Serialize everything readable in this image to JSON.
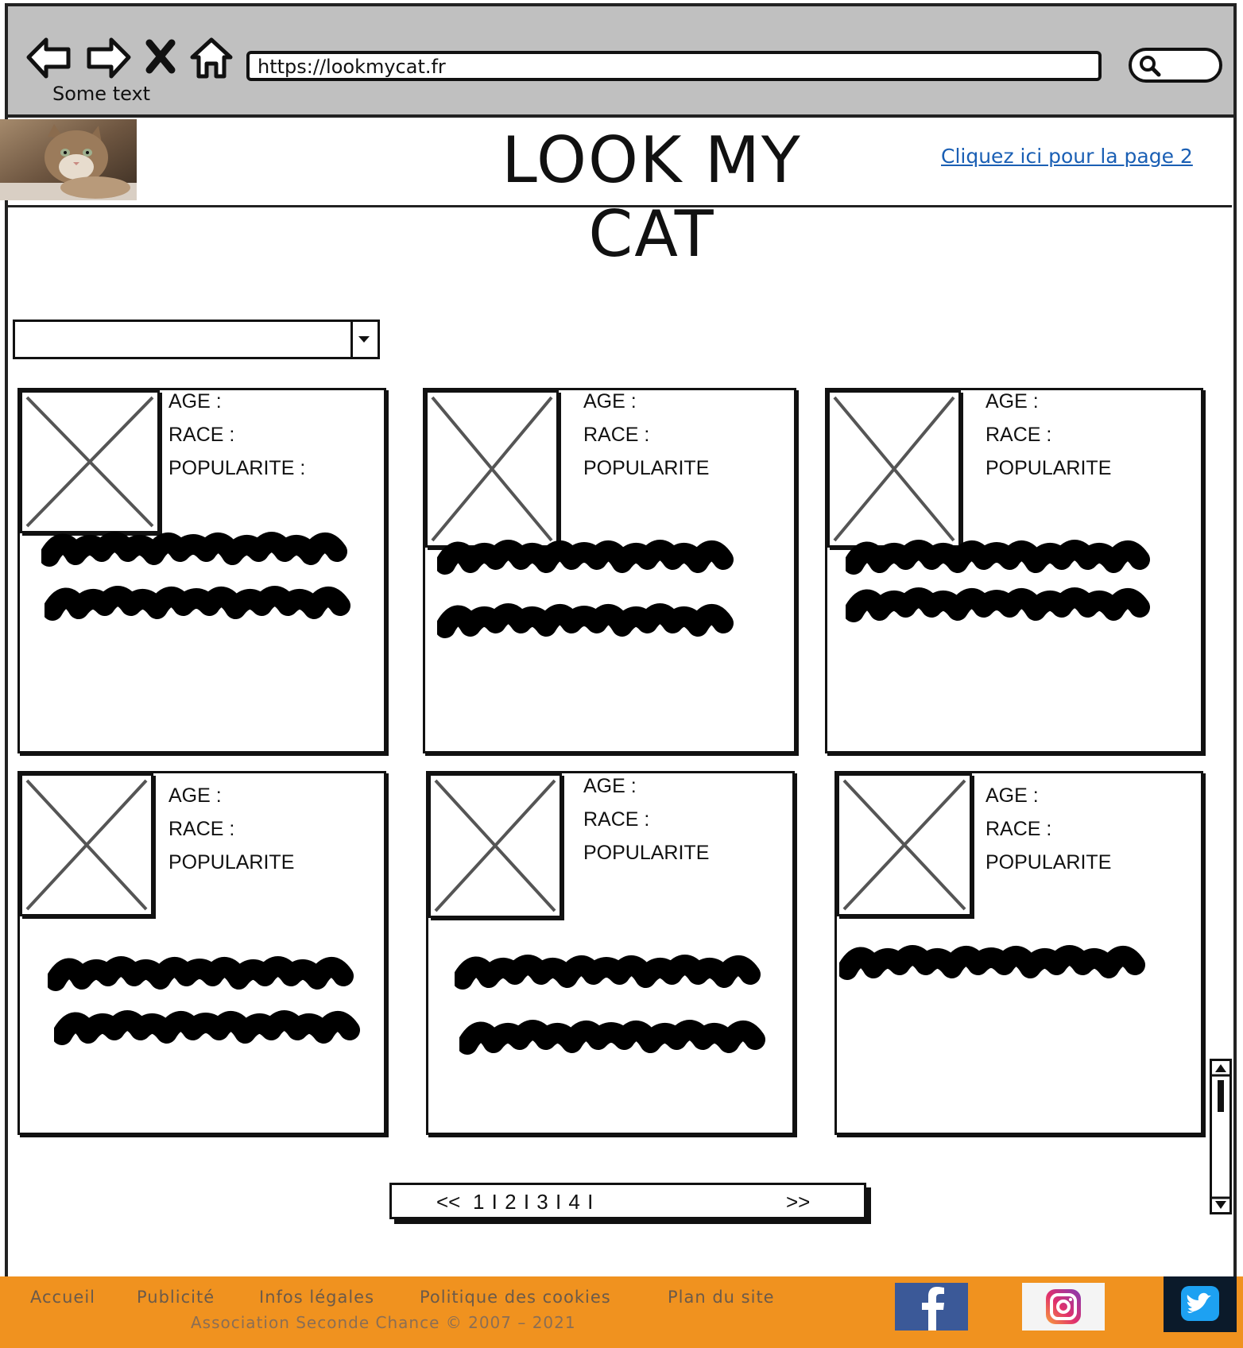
{
  "browser": {
    "url": "https://lookmycat.fr",
    "caption": "Some text"
  },
  "header": {
    "title": "LOOK MY CAT",
    "link": "Cliquez ici  pour la page 2"
  },
  "cards": [
    {
      "age": "AGE :",
      "race": "RACE :",
      "popularite": "POPULARITE :"
    },
    {
      "age": "AGE :",
      "race": "RACE :",
      "popularite": "POPULARITE"
    },
    {
      "age": "AGE :",
      "race": "RACE :",
      "popularite": "POPULARITE"
    },
    {
      "age": "AGE :",
      "race": "RACE :",
      "popularite": "POPULARITE"
    },
    {
      "age": "AGE :",
      "race": "RACE :",
      "popularite": "POPULARITE"
    },
    {
      "age": "AGE :",
      "race": "RACE :",
      "popularite": "POPULARITE"
    }
  ],
  "pagination": {
    "prev": "<<",
    "pages": "1 I 2 I 3 I 4 I",
    "next": ">>"
  },
  "footer": {
    "links": [
      "Accueil",
      "Publicité",
      "Infos légales",
      "Politique des cookies",
      "Plan du site"
    ],
    "copyright": "Association Seconde Chance © 2007 – 2021"
  },
  "colors": {
    "footer_bg": "#f0921f",
    "link": "#1a5fb4",
    "chrome": "#c0c0c0"
  }
}
